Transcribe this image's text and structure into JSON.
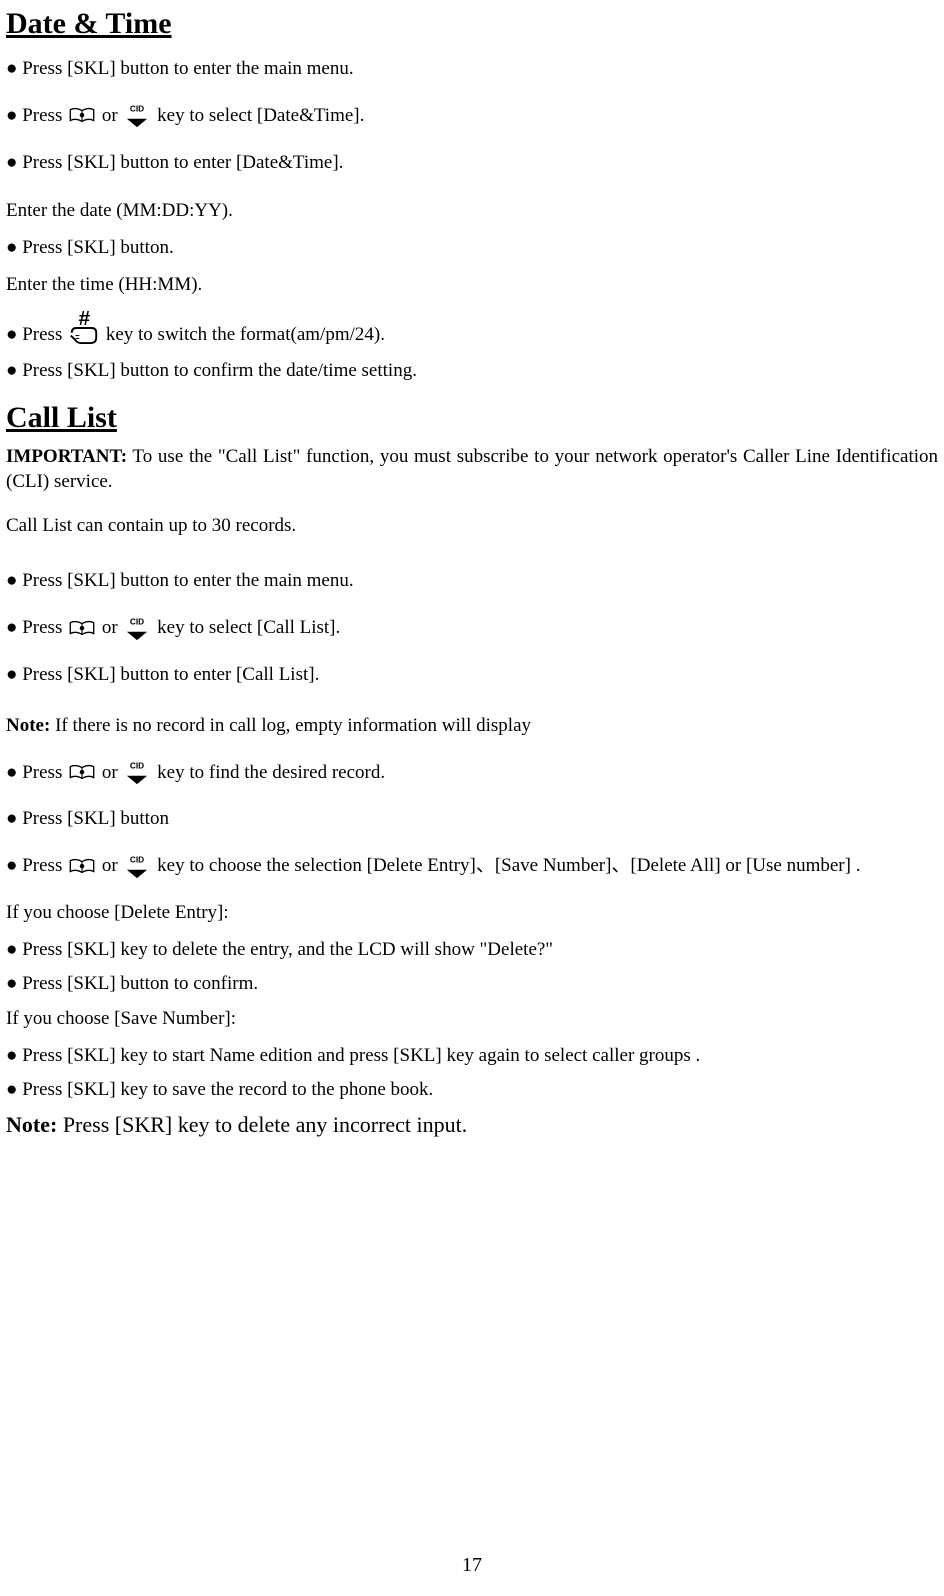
{
  "section1": {
    "title": "Date & Time",
    "b1": "●  Press [SKL] button to enter the main menu.",
    "b2a": "●  Press ",
    "b2b": " or ",
    "b2c": " key to select [Date&Time].",
    "b3": "●  Press [SKL] button to enter [Date&Time].",
    "p1": "Enter the date (MM:DD:YY).",
    "b4": "●  Press [SKL] button.",
    "p2": "Enter the time (HH:MM).",
    "b5a": "●  Press  ",
    "b5b": "  key to switch the format(am/pm/24).",
    "b6": "●  Press [SKL] button to confirm the date/time setting."
  },
  "section2": {
    "title": "Call List",
    "imp_label": "IMPORTANT:",
    "imp_text": " To  use  the  \"Call  List\"  function,  you  must  subscribe  to  your  network  operator's  Caller  Line Identification (CLI) service.",
    "p1": "Call List can contain up to 30 records.",
    "b1": "●  Press [SKL] button to enter the main menu.",
    "b2a": "●  Press ",
    "b2b": " or ",
    "b2c": " key to select [Call List].",
    "b3": "●  Press [SKL] button to enter [Call List].",
    "note1_label": "Note:",
    "note1_text": " If there is no record in call log, empty information will display",
    "b4a": "●  Press ",
    "b4b": " or ",
    "b4c": " key to find the desired record.",
    "b5": "●  Press [SKL] button",
    "b6a": "●  Press ",
    "b6b": " or ",
    "b6c": " key to choose the selection [Delete Entry]、[Save Number]、[Delete All] or [Use number] .",
    "p2": "  If you choose [Delete Entry]:",
    "b7": "● Press [SKL] key to delete the entry, and the LCD will show \"Delete?\"",
    "b8": "●  Press [SKL] button to confirm.",
    "p3": "If you choose [Save Number]:",
    "b9": "●  Press [SKL] key to start Name edition and press [SKL] key again to select caller groups .",
    "b10": "●  Press [SKL] key to save the record to the phone book.",
    "note2_label": "Note:",
    "note2_text": " Press [SKR] key to delete any incorrect input."
  },
  "pagenum": "17"
}
